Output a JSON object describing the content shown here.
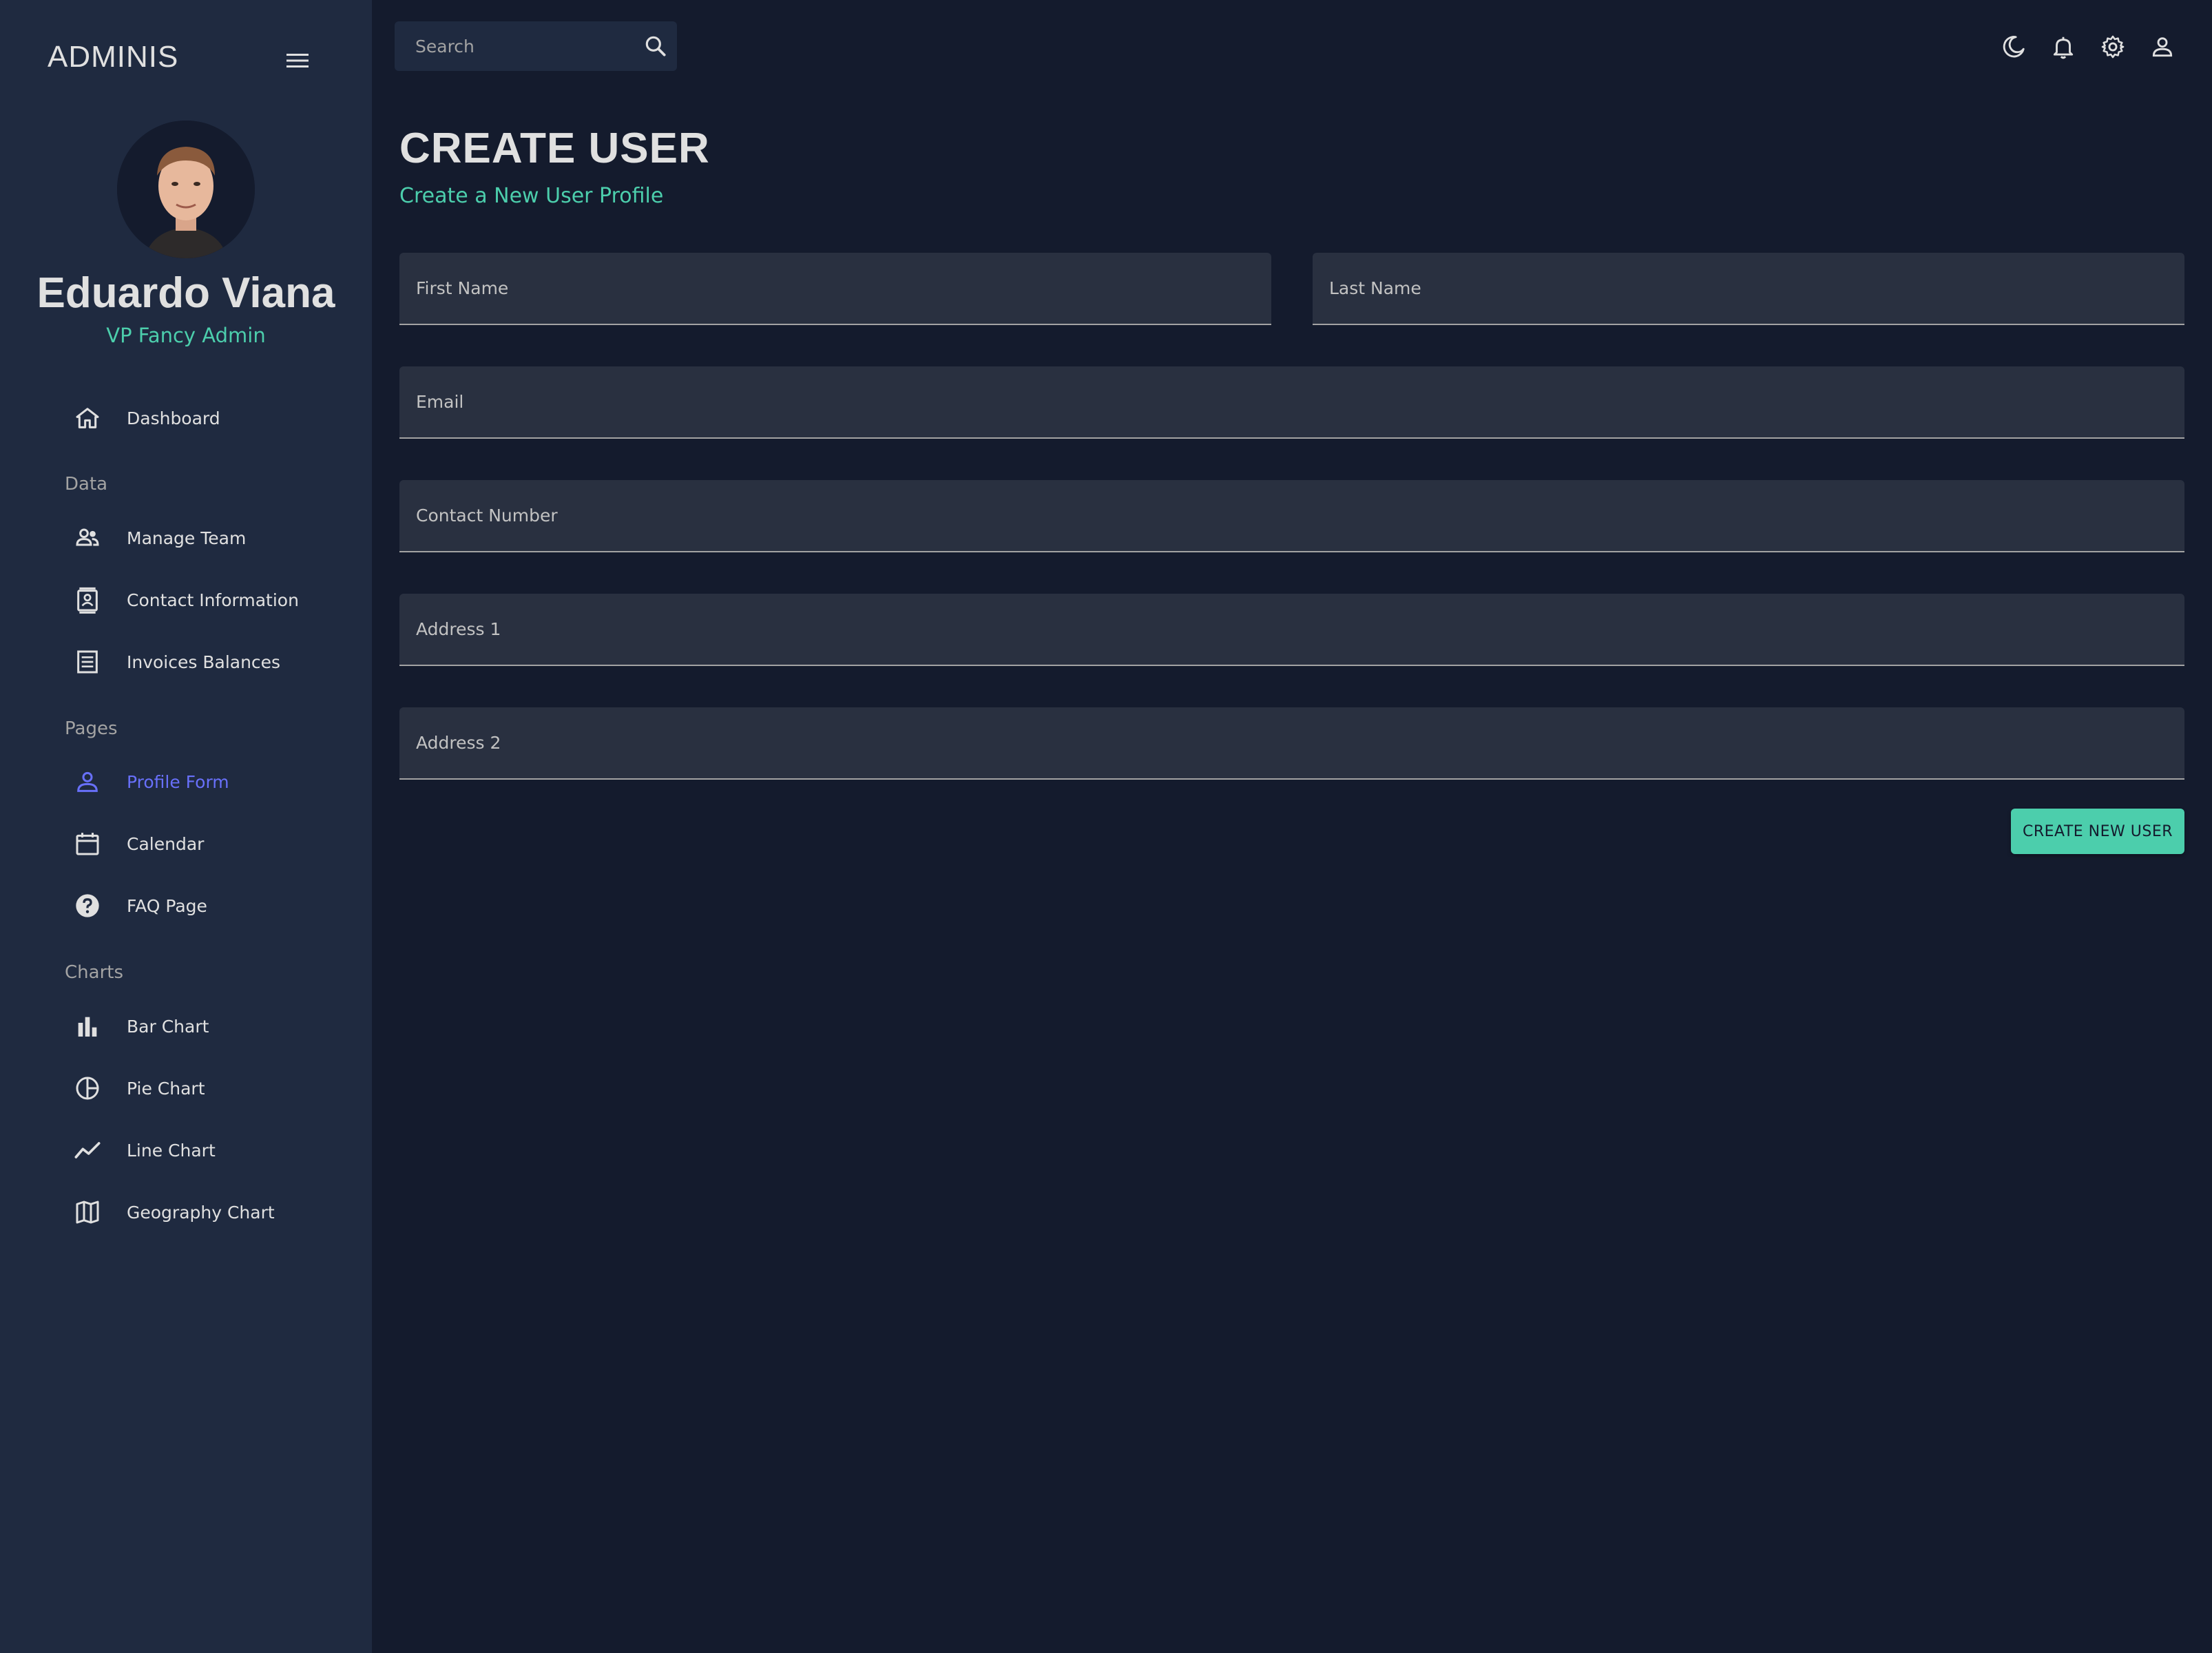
{
  "app": {
    "brand": "ADMINIS"
  },
  "profile": {
    "name": "Eduardo Viana",
    "role": "VP Fancy Admin"
  },
  "sidebar": {
    "dashboard": "Dashboard",
    "sections": {
      "data": "Data",
      "pages": "Pages",
      "charts": "Charts"
    },
    "data_items": [
      "Manage Team",
      "Contact Information",
      "Invoices Balances"
    ],
    "page_items": [
      "Profile Form",
      "Calendar",
      "FAQ Page"
    ],
    "chart_items": [
      "Bar Chart",
      "Pie Chart",
      "Line Chart",
      "Geography Chart"
    ],
    "active": "Profile Form"
  },
  "topbar": {
    "search_placeholder": "Search"
  },
  "main": {
    "title": "CREATE USER",
    "subtitle": "Create a New User Profile",
    "fields": {
      "first_name": "First Name",
      "last_name": "Last Name",
      "email": "Email",
      "contact": "Contact Number",
      "address1": "Address 1",
      "address2": "Address 2"
    },
    "submit_label": "CREATE NEW USER"
  },
  "colors": {
    "background": "#141b2d",
    "sidebar": "#1f2a40",
    "accent_green": "#4cceac",
    "accent_blue": "#6870fa",
    "field_bg": "#293040"
  }
}
